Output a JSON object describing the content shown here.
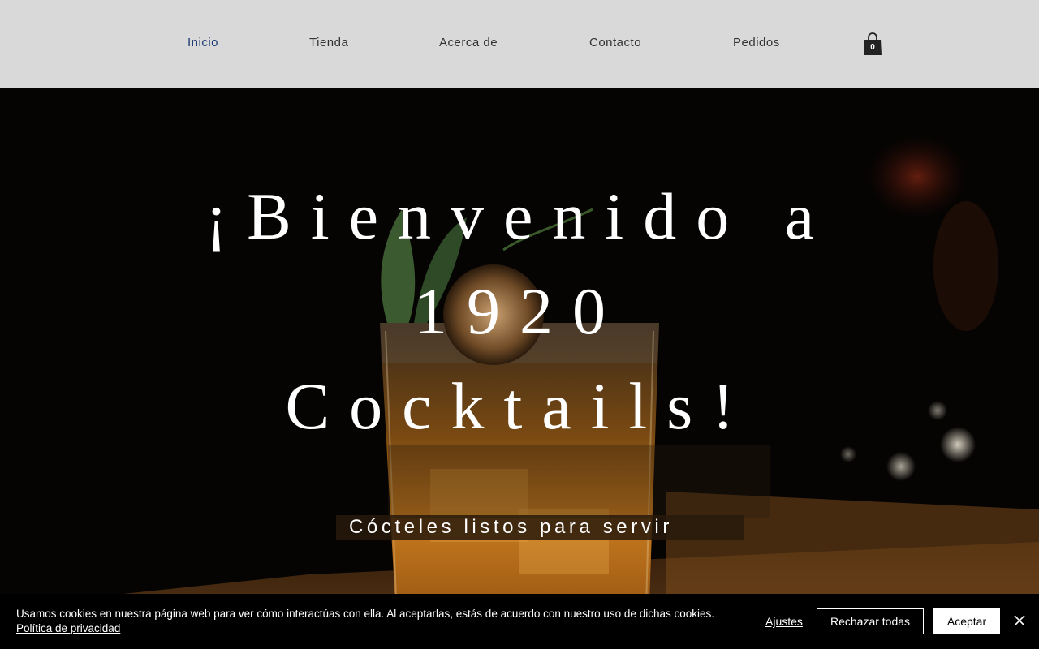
{
  "nav": {
    "items": [
      {
        "label": "Inicio",
        "active": true
      },
      {
        "label": "Tienda",
        "active": false
      },
      {
        "label": "Acerca de",
        "active": false
      },
      {
        "label": "Contacto",
        "active": false
      },
      {
        "label": "Pedidos",
        "active": false
      }
    ],
    "cart_icon": "shopping-bag-icon",
    "cart_count": "0"
  },
  "hero": {
    "title_lines": [
      "¡Bienvenido a",
      "1920",
      "Cocktails!"
    ],
    "subtitle": "Cócteles listos para servir"
  },
  "cookie_banner": {
    "text": "Usamos cookies en nuestra página web para ver cómo interactúas con ella. Al aceptarlas, estás de acuerdo con nuestro uso de dichas cookies.",
    "privacy_link": "Política de privacidad",
    "settings_label": "Ajustes",
    "reject_label": "Rechazar todas",
    "accept_label": "Aceptar",
    "close_icon": "close-icon"
  },
  "colors": {
    "header_bg": "#d9d9d9",
    "nav_active": "#1f3b73",
    "nav_text": "#333333",
    "cookie_bg": "#000000"
  }
}
